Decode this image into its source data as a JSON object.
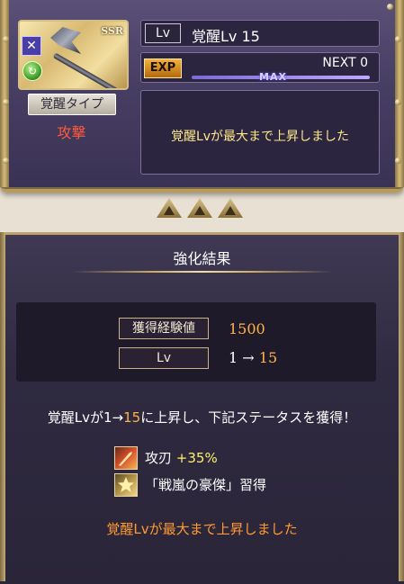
{
  "awakening": {
    "rarity": "SSR",
    "type_label": "覚醒タイプ",
    "type_value": "攻撃",
    "lv_tag": "Lv",
    "lv_text": "覚醒Lv 15",
    "exp_tag": "EXP",
    "next_text": "NEXT 0",
    "max_label": "MAX",
    "exp_progress": 1.0,
    "message": "覚醒Lvが最大まで上昇しました"
  },
  "result": {
    "title": "強化結果",
    "exp_tag": "獲得経験値",
    "exp_value": "1500",
    "lv_tag": "Lv",
    "lv_from": "1 →",
    "lv_to": "15",
    "summary_pre": "覚醒Lvが1→",
    "summary_hl": "15",
    "summary_post": "に上昇し、下記ステータスを獲得！",
    "rewards": [
      {
        "icon": "sword-icon",
        "label": "攻刃",
        "value": "+35%"
      },
      {
        "icon": "star-icon",
        "label": "「戦嵐の豪傑」習得",
        "value": ""
      }
    ],
    "final_message": "覚醒Lvが最大まで上昇しました"
  },
  "colors": {
    "accent_orange": "#ffb347",
    "message_yellow": "#ffe889",
    "attack_red": "#ff5a3c"
  }
}
